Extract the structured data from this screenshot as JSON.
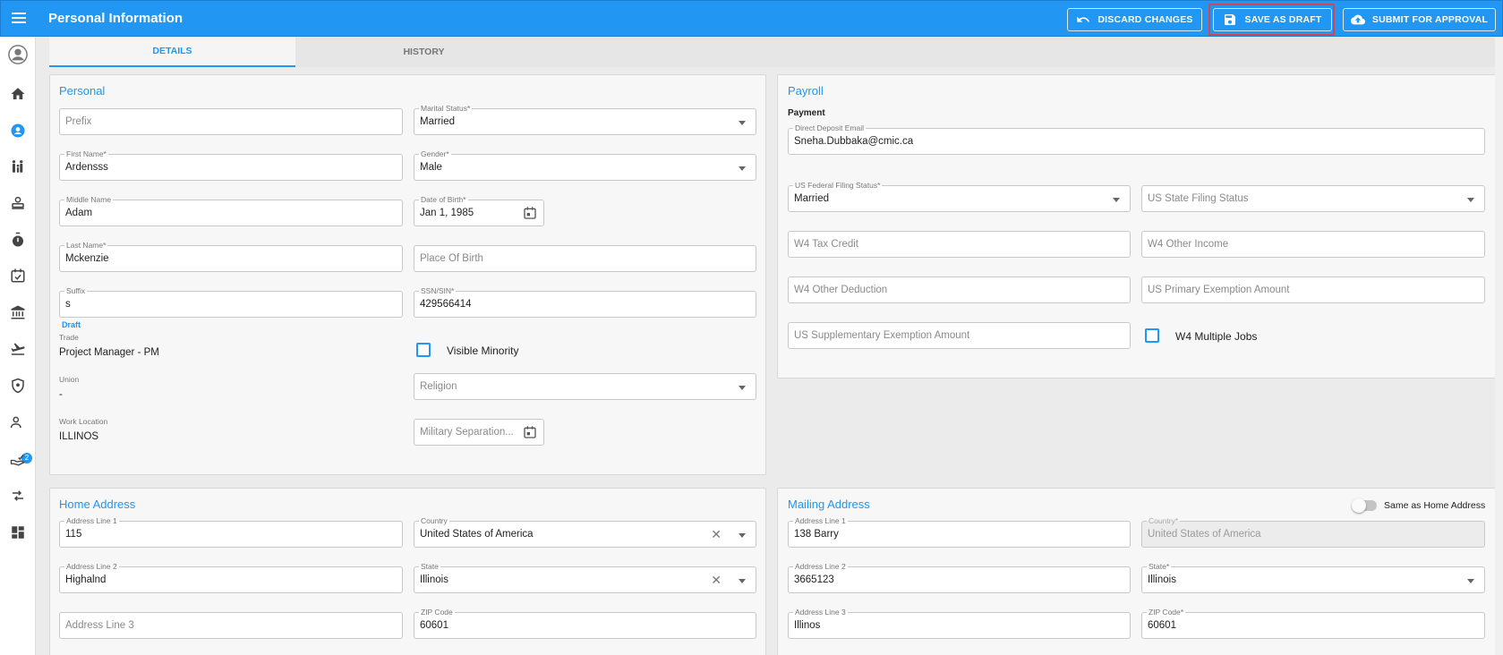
{
  "app": {
    "title": "Personal Information"
  },
  "actions": {
    "discard": "DISCARD CHANGES",
    "save_draft": "SAVE AS DRAFT",
    "submit": "SUBMIT FOR APPROVAL"
  },
  "nav": {
    "icons": [
      "avatar-icon",
      "home-icon",
      "person-icon",
      "family-icon",
      "badge-icon",
      "stopwatch-icon",
      "calendar-check-icon",
      "bank-icon",
      "flight-icon",
      "shield-icon",
      "people-approval-icon",
      "hand-check-icon",
      "swap-icon",
      "dashboard-icon"
    ],
    "badge_count": "2"
  },
  "tabs": [
    {
      "label": "DETAILS"
    },
    {
      "label": "HISTORY"
    }
  ],
  "personal": {
    "title": "Personal",
    "prefix": {
      "placeholder": "Prefix"
    },
    "marital_status": {
      "label": "Marital Status*",
      "value": "Married"
    },
    "first_name": {
      "label": "First Name*",
      "value": "Ardensss"
    },
    "gender": {
      "label": "Gender*",
      "value": "Male"
    },
    "middle_name": {
      "label": "Middle Name",
      "value": "Adam"
    },
    "dob": {
      "label": "Date of Birth*",
      "value": "Jan 1, 1985"
    },
    "last_name": {
      "label": "Last Name*",
      "value": "Mckenzie"
    },
    "place_of_birth": {
      "placeholder": "Place Of Birth"
    },
    "suffix": {
      "label": "Suffix",
      "value": "s"
    },
    "ssn": {
      "label": "SSN/SIN*",
      "value": "429566414"
    },
    "draft_tag": "Draft",
    "trade": {
      "label": "Trade",
      "value": "Project Manager - PM"
    },
    "visible_minority": "Visible Minority",
    "union": {
      "label": "Union",
      "value": "-"
    },
    "religion": {
      "placeholder": "Religion"
    },
    "work_location": {
      "label": "Work Location",
      "value": "ILLINOS"
    },
    "military_separation": {
      "placeholder": "Military Separation..."
    }
  },
  "payroll": {
    "title": "Payroll",
    "payment_heading": "Payment",
    "direct_deposit_email": {
      "label": "Direct Deposit Email",
      "value": "Sneha.Dubbaka@cmic.ca"
    },
    "us_federal_filing_status": {
      "label": "US Federal Filing Status*",
      "value": "Married"
    },
    "us_state_filing_status": {
      "placeholder": "US State Filing Status"
    },
    "w4_tax_credit": {
      "placeholder": "W4 Tax Credit"
    },
    "w4_other_income": {
      "placeholder": "W4 Other Income"
    },
    "w4_other_deduction": {
      "placeholder": "W4 Other Deduction"
    },
    "us_primary_exemption": {
      "placeholder": "US Primary Exemption Amount"
    },
    "us_supplementary_exemption": {
      "placeholder": "US Supplementary Exemption Amount"
    },
    "w4_multiple_jobs": "W4 Multiple Jobs"
  },
  "home_address": {
    "title": "Home Address",
    "line1": {
      "label": "Address Line 1",
      "value": "115"
    },
    "country": {
      "label": "Country",
      "value": "United States of America"
    },
    "line2": {
      "label": "Address Line 2",
      "value": "Highalnd"
    },
    "state": {
      "label": "State",
      "value": "Illinois"
    },
    "line3": {
      "placeholder": "Address Line 3"
    },
    "zip": {
      "label": "ZIP Code",
      "value": "60601"
    }
  },
  "mailing_address": {
    "title": "Mailing Address",
    "same_as_home": "Same as Home Address",
    "line1": {
      "label": "Address Line 1",
      "value": "138 Barry"
    },
    "country": {
      "label": "Country*",
      "value": "United States of America"
    },
    "line2": {
      "label": "Address Line 2",
      "value": "3665123"
    },
    "state": {
      "label": "State*",
      "value": "Illinois"
    },
    "line3": {
      "label": "Address Line 3",
      "value": "Illinos"
    },
    "zip": {
      "label": "ZIP Code*",
      "value": "60601"
    }
  },
  "colors": {
    "primary": "#2196f3",
    "highlight": "#d64555"
  }
}
